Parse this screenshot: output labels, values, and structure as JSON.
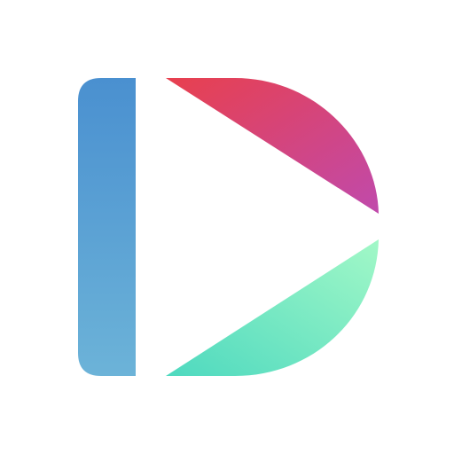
{
  "logo": {
    "icon": "stylized-letter-d-logo-icon",
    "background_color": "#ffffff",
    "colors": {
      "bar_top": "#4a90d0",
      "bar_bottom": "#6cb3d8",
      "upper_wedge_start": "#e8404e",
      "upper_wedge_end": "#c04aac",
      "lower_wedge_start": "#4ed9bf",
      "lower_wedge_end": "#a2f8c7"
    }
  }
}
